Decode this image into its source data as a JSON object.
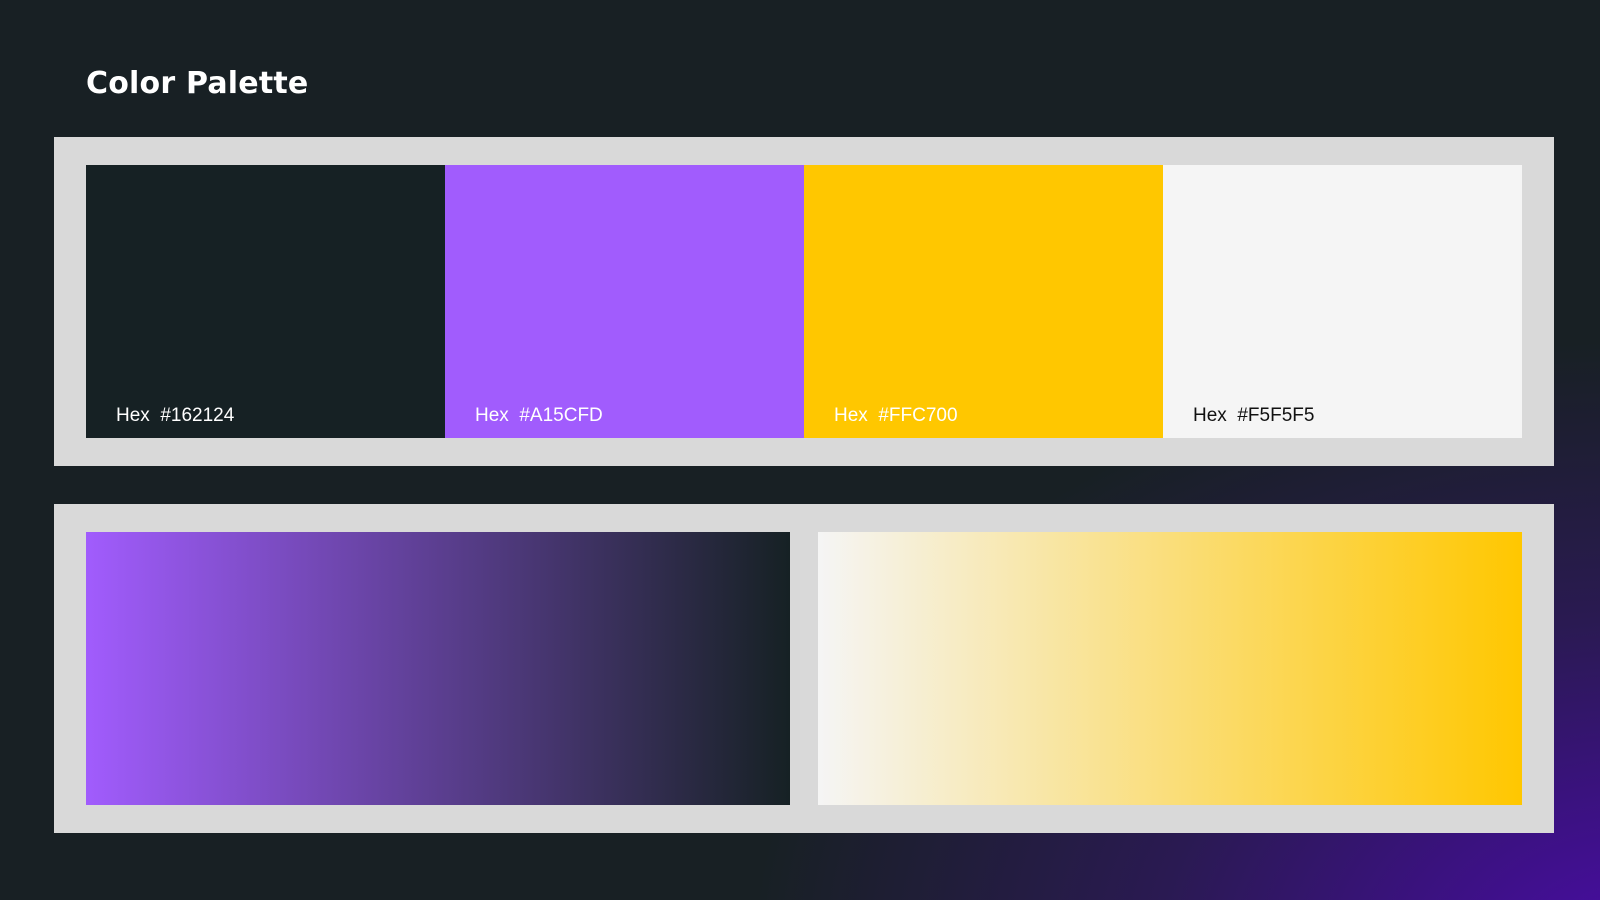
{
  "page": {
    "title": "Color Palette",
    "background_color": "#182024",
    "background_glow": "#4a0ca8"
  },
  "swatches": [
    {
      "label": "Hex  #162124",
      "color": "#162124",
      "label_color": "#ffffff"
    },
    {
      "label": "Hex  #A15CFD",
      "color": "#A15CFD",
      "label_color": "#ffffff"
    },
    {
      "label": "Hex  #FFC700",
      "color": "#FFC700",
      "label_color": "#ffffff"
    },
    {
      "label": "Hex  #F5F5F5",
      "color": "#F5F5F5",
      "label_color": "#111111"
    }
  ],
  "gradients": [
    {
      "from": "#A15CFD",
      "to": "#162124"
    },
    {
      "from": "#F5F5F5",
      "to": "#FFC700"
    }
  ],
  "panel_color": "#D9D9D9"
}
